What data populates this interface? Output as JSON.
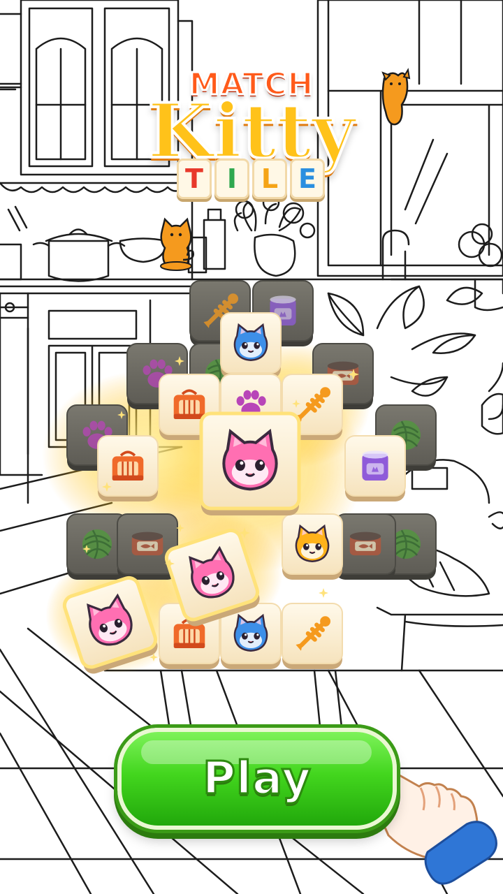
{
  "logo": {
    "line1": "MATCH",
    "line2": "Kitty",
    "line3_letters": [
      "T",
      "I",
      "L",
      "E"
    ],
    "line3_colors": [
      "#e8392b",
      "#2fa84f",
      "#f5a416",
      "#2a8fe0"
    ]
  },
  "play_button": {
    "label": "Play"
  },
  "colors": {
    "accent_green": "#43d61e",
    "tile_face": "#fdf3dc",
    "tile_dark": "#6b6a62",
    "glow": "#ffd23a"
  },
  "tiles": {
    "dark": [
      {
        "id": "d1",
        "icon": "fish-bone-icon"
      },
      {
        "id": "d2",
        "icon": "cat-food-can-icon"
      },
      {
        "id": "d3",
        "icon": "paw-print-icon"
      },
      {
        "id": "d4",
        "icon": "yarn-ball-icon"
      },
      {
        "id": "d5",
        "icon": "fish-can-icon"
      },
      {
        "id": "d6",
        "icon": "paw-print-icon"
      },
      {
        "id": "d7",
        "icon": "yarn-ball-icon"
      },
      {
        "id": "d8",
        "icon": "yarn-ball-icon"
      },
      {
        "id": "d9",
        "icon": "fish-can-icon"
      },
      {
        "id": "d10",
        "icon": "yarn-ball-icon"
      },
      {
        "id": "d11",
        "icon": "fish-can-icon"
      }
    ],
    "light": [
      {
        "id": "l1",
        "icon": "blue-cat-icon"
      },
      {
        "id": "l2",
        "icon": "pet-carrier-icon"
      },
      {
        "id": "l3",
        "icon": "paw-print-icon"
      },
      {
        "id": "l4",
        "icon": "fish-bone-icon"
      },
      {
        "id": "l5",
        "icon": "pet-carrier-icon"
      },
      {
        "id": "l6",
        "icon": "cat-food-can-icon"
      },
      {
        "id": "l7",
        "icon": "orange-cat-icon"
      },
      {
        "id": "l8",
        "icon": "pet-carrier-icon"
      },
      {
        "id": "l9",
        "icon": "blue-cat-icon"
      },
      {
        "id": "l10",
        "icon": "fish-bone-icon"
      }
    ],
    "selected": [
      {
        "id": "s1",
        "icon": "pink-cat-icon"
      },
      {
        "id": "s2",
        "icon": "pink-cat-icon"
      },
      {
        "id": "s3",
        "icon": "pink-cat-icon"
      }
    ]
  }
}
